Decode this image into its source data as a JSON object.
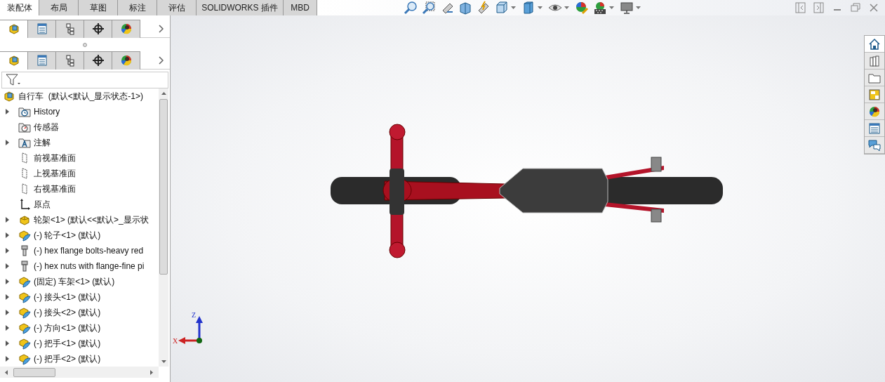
{
  "tabs": [
    {
      "label": "装配体",
      "selected": true
    },
    {
      "label": "布局",
      "selected": false
    },
    {
      "label": "草图",
      "selected": false
    },
    {
      "label": "标注",
      "selected": false
    },
    {
      "label": "评估",
      "selected": false
    },
    {
      "label": "SOLIDWORKS 插件",
      "selected": false
    },
    {
      "label": "MBD",
      "selected": false
    }
  ],
  "panel_tab_rows": [
    {
      "tabs": [
        {
          "selected": true
        },
        {
          "selected": false
        },
        {
          "selected": false
        },
        {
          "selected": false
        },
        {
          "selected": false
        }
      ]
    },
    {
      "tabs": [
        {
          "selected": true
        },
        {
          "selected": false
        },
        {
          "selected": false
        },
        {
          "selected": false
        },
        {
          "selected": false
        }
      ]
    }
  ],
  "tree": {
    "label": "自行车  (默认<默认_显示状态-1>)",
    "kind": "assembly",
    "children": [
      {
        "label": "History",
        "kind": "history",
        "expander": true
      },
      {
        "label": "传感器",
        "kind": "sensor",
        "expander": false
      },
      {
        "label": "注解",
        "kind": "annotation",
        "expander": true
      },
      {
        "label": "前视基准面",
        "kind": "plane",
        "expander": false
      },
      {
        "label": "上视基准面",
        "kind": "plane",
        "expander": false
      },
      {
        "label": "右视基准面",
        "kind": "plane",
        "expander": false
      },
      {
        "label": "原点",
        "kind": "origin",
        "expander": false
      },
      {
        "label": "轮架<1> (默认<<默认>_显示状",
        "kind": "subassembly",
        "expander": true
      },
      {
        "label": "(-) 轮子<1> (默认)",
        "kind": "part",
        "expander": true
      },
      {
        "label": "(-) hex flange bolts-heavy red",
        "kind": "bolt",
        "expander": true
      },
      {
        "label": "(-) hex nuts with flange-fine pi",
        "kind": "bolt",
        "expander": true
      },
      {
        "label": "(固定) 车架<1> (默认)",
        "kind": "part",
        "expander": true
      },
      {
        "label": "(-) 接头<1> (默认)",
        "kind": "part",
        "expander": true
      },
      {
        "label": "(-) 接头<2> (默认)",
        "kind": "part",
        "expander": true
      },
      {
        "label": "(-) 方向<1> (默认)",
        "kind": "part",
        "expander": true
      },
      {
        "label": "(-) 把手<1> (默认)",
        "kind": "part",
        "expander": true
      },
      {
        "label": "(-) 把手<2> (默认)",
        "kind": "part",
        "expander": true
      }
    ]
  },
  "triad": {
    "z": "Z",
    "x": "X"
  }
}
